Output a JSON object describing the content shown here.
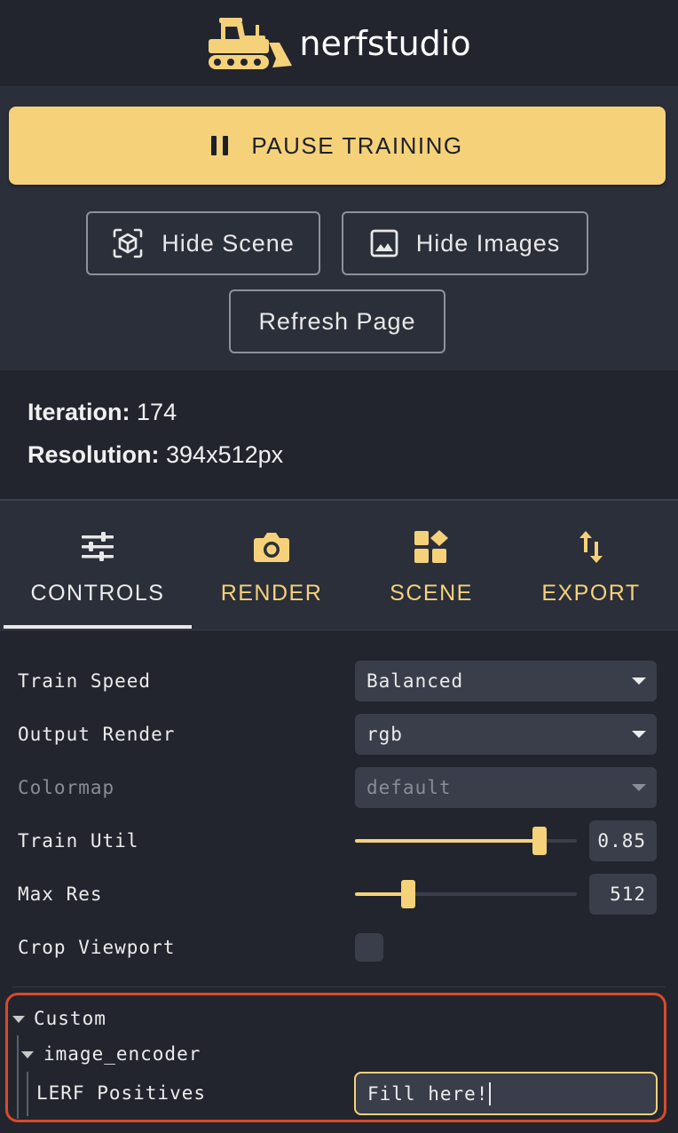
{
  "header": {
    "logo_text": "nerfstudio",
    "logo_icon": "bulldozer-icon"
  },
  "colors": {
    "accent": "#f5d27a",
    "background": "#22252e",
    "panel": "#2b2f3a",
    "input": "#3a3e4b",
    "highlight": "#d84a2c"
  },
  "actions": {
    "pause_label": "PAUSE TRAINING",
    "hide_scene_label": "Hide Scene",
    "hide_images_label": "Hide Images",
    "refresh_label": "Refresh Page"
  },
  "status": {
    "iteration_label": "Iteration:",
    "iteration_value": "174",
    "resolution_label": "Resolution:",
    "resolution_value": "394x512px"
  },
  "tabs": [
    {
      "label": "CONTROLS",
      "icon": "sliders-icon",
      "active": true
    },
    {
      "label": "RENDER",
      "icon": "camera-icon",
      "active": false
    },
    {
      "label": "SCENE",
      "icon": "shapes-icon",
      "active": false
    },
    {
      "label": "EXPORT",
      "icon": "swap-vertical-icon",
      "active": false
    }
  ],
  "controls": {
    "train_speed": {
      "label": "Train Speed",
      "value": "Balanced"
    },
    "output_render": {
      "label": "Output Render",
      "value": "rgb"
    },
    "colormap": {
      "label": "Colormap",
      "value": "default",
      "disabled": true
    },
    "train_util": {
      "label": "Train Util",
      "value": "0.85",
      "fraction": 0.83
    },
    "max_res": {
      "label": "Max Res",
      "value": "512",
      "fraction": 0.24
    },
    "crop_viewport": {
      "label": "Crop Viewport",
      "checked": false
    }
  },
  "custom": {
    "folder_label": "Custom",
    "subfolder_label": "image_encoder",
    "lerf_positives": {
      "label": "LERF Positives",
      "value": "Fill here!"
    }
  }
}
